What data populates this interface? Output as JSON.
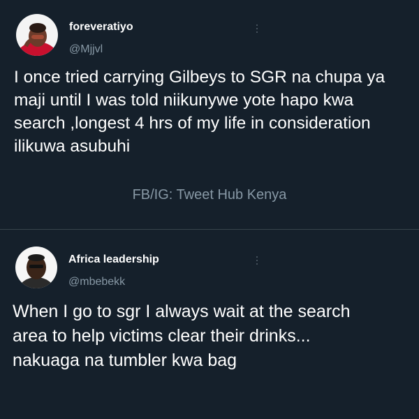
{
  "tweet1": {
    "display_name": "foreveratiyo",
    "handle": "@Mjjvl",
    "text_lines": [
      "I once tried carrying Gilbeys to SGR na chupa ya",
      "maji until I was told niikunywe yote hapo kwa",
      "search ,longest 4 hrs of my life in consideration",
      "ilikuwa asubuhi"
    ]
  },
  "watermark": "FB/IG: Tweet Hub Kenya",
  "tweet2": {
    "display_name": "Africa leadership",
    "handle": "@mbebekk",
    "text_lines": [
      "When I go to sgr I always wait at the search",
      "area to help victims clear their drinks...",
      "nakuaga na tumbler kwa bag"
    ]
  },
  "colors": {
    "background": "#15202b",
    "text": "#ffffff",
    "secondary_text": "#8899a6",
    "divider": "#38444d"
  }
}
